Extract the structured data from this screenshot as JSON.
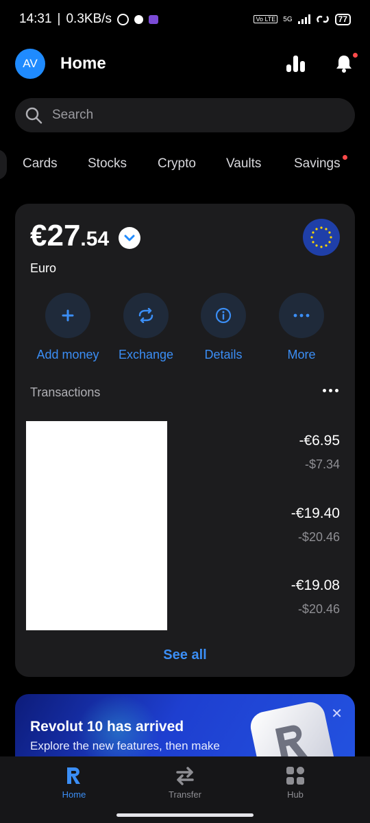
{
  "status_bar": {
    "time": "14:31",
    "speed": "0.3KB/s",
    "network": "5G",
    "volte": "Vo LTE",
    "battery": "77"
  },
  "header": {
    "avatar_initials": "AV",
    "title": "Home"
  },
  "search": {
    "placeholder": "Search"
  },
  "tabs": [
    {
      "label": "Cards"
    },
    {
      "label": "Stocks"
    },
    {
      "label": "Crypto"
    },
    {
      "label": "Vaults"
    },
    {
      "label": "Savings"
    }
  ],
  "account": {
    "balance_main": "€27",
    "balance_decimal": ".54",
    "currency_name": "Euro"
  },
  "actions": [
    {
      "label": "Add money",
      "icon": "plus-icon"
    },
    {
      "label": "Exchange",
      "icon": "exchange-icon"
    },
    {
      "label": "Details",
      "icon": "info-icon"
    },
    {
      "label": "More",
      "icon": "more-dots-icon"
    }
  ],
  "transactions": {
    "heading": "Transactions",
    "items": [
      {
        "amount_eur": "-€6.95",
        "amount_usd": "-$7.34"
      },
      {
        "amount_eur": "-€19.40",
        "amount_usd": "-$20.46"
      },
      {
        "amount_eur": "-€19.08",
        "amount_usd": "-$20.46"
      }
    ],
    "see_all": "See all"
  },
  "promo": {
    "title": "Revolut 10 has arrived",
    "subtitle": "Explore the new features, then make"
  },
  "bottom_nav": [
    {
      "label": "Home",
      "icon": "revolut-r-icon",
      "active": true
    },
    {
      "label": "Transfer",
      "icon": "transfer-arrows-icon",
      "active": false
    },
    {
      "label": "Hub",
      "icon": "hub-grid-icon",
      "active": false
    }
  ],
  "colors": {
    "accent": "#3b8ef5",
    "card_bg": "#1c1c1e",
    "background": "#000000",
    "notification_dot": "#ff4a4a"
  }
}
